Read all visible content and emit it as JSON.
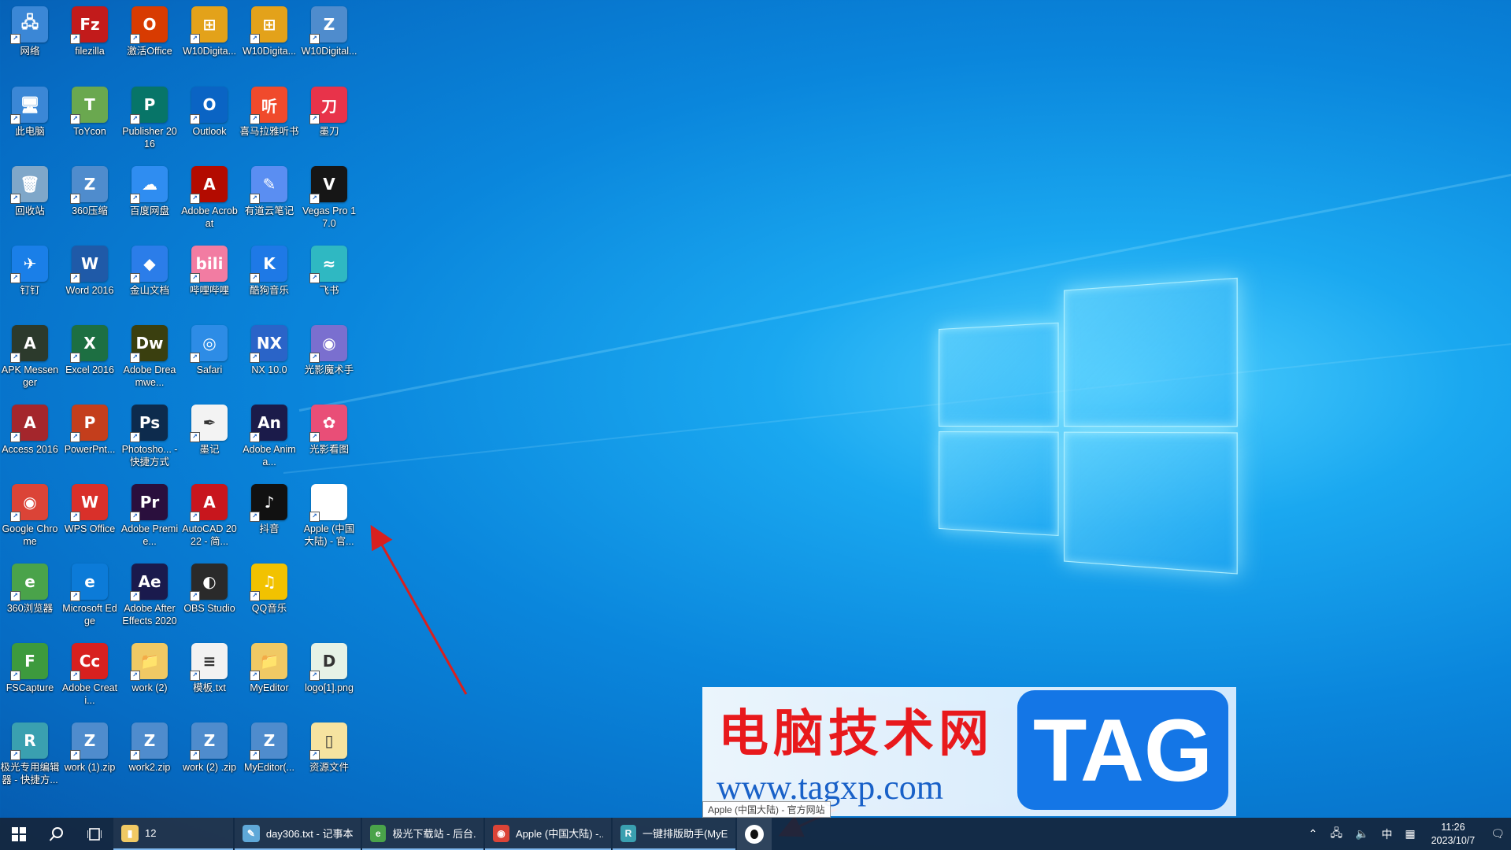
{
  "desktop": {
    "icons": [
      {
        "label": "网络",
        "glyph": "🖧",
        "color": "#3b87d6"
      },
      {
        "label": "filezilla",
        "glyph": "Fz",
        "color": "#c21b1b"
      },
      {
        "label": "激活Office",
        "glyph": "O",
        "color": "#d83b01"
      },
      {
        "label": "W10Digita...",
        "glyph": "⊞",
        "color": "#e3a21a"
      },
      {
        "label": "W10Digita...",
        "glyph": "⊞",
        "color": "#e3a21a"
      },
      {
        "label": "W10Digital...",
        "glyph": "Z",
        "color": "#4f8ccd"
      },
      {
        "label": "此电脑",
        "glyph": "🖥",
        "color": "#3b87d6"
      },
      {
        "label": "ToYcon",
        "glyph": "T",
        "color": "#6aa84f"
      },
      {
        "label": "Publisher 2016",
        "glyph": "P",
        "color": "#077568"
      },
      {
        "label": "Outlook",
        "glyph": "O",
        "color": "#0a64c4"
      },
      {
        "label": "喜马拉雅听书",
        "glyph": "听",
        "color": "#f04a2c"
      },
      {
        "label": "墨刀",
        "glyph": "刀",
        "color": "#e8334a"
      },
      {
        "label": "回收站",
        "glyph": "🗑",
        "color": "#7fa7c9"
      },
      {
        "label": "360压缩",
        "glyph": "Z",
        "color": "#4f8ccd"
      },
      {
        "label": "百度网盘",
        "glyph": "☁",
        "color": "#2f8df1"
      },
      {
        "label": "Adobe Acrobat",
        "glyph": "A",
        "color": "#b30b00"
      },
      {
        "label": "有道云笔记",
        "glyph": "✎",
        "color": "#5a8ef2"
      },
      {
        "label": "Vegas Pro 17.0",
        "glyph": "V",
        "color": "#161616"
      },
      {
        "label": "钉钉",
        "glyph": "✈",
        "color": "#1a7fe8"
      },
      {
        "label": "Word 2016",
        "glyph": "W",
        "color": "#1f5aa8"
      },
      {
        "label": "金山文档",
        "glyph": "◆",
        "color": "#2b7de9"
      },
      {
        "label": "哔哩哔哩",
        "glyph": "bili",
        "color": "#f27ca2"
      },
      {
        "label": "酷狗音乐",
        "glyph": "K",
        "color": "#1e79e6"
      },
      {
        "label": "飞书",
        "glyph": "≈",
        "color": "#2fb8c2"
      },
      {
        "label": "APK Messenger",
        "glyph": "A",
        "color": "#2c3a2c"
      },
      {
        "label": "Excel 2016",
        "glyph": "X",
        "color": "#1d6f42"
      },
      {
        "label": "Adobe Dreamwe...",
        "glyph": "Dw",
        "color": "#3a3f0f"
      },
      {
        "label": "Safari",
        "glyph": "◎",
        "color": "#2d8ce6"
      },
      {
        "label": "NX 10.0",
        "glyph": "NX",
        "color": "#2a64c8"
      },
      {
        "label": "光影魔术手",
        "glyph": "◉",
        "color": "#7a6fcf"
      },
      {
        "label": "Access 2016",
        "glyph": "A",
        "color": "#a4262c"
      },
      {
        "label": "PowerPnt...",
        "glyph": "P",
        "color": "#c43e1c"
      },
      {
        "label": "Photosho... - 快捷方式",
        "glyph": "Ps",
        "color": "#0d2b4d"
      },
      {
        "label": "墨记",
        "glyph": "✒",
        "color": "#f3f3f3"
      },
      {
        "label": "Adobe Anima...",
        "glyph": "An",
        "color": "#1b1b4a"
      },
      {
        "label": "光影看图",
        "glyph": "✿",
        "color": "#e94e77"
      },
      {
        "label": "Google Chrome",
        "glyph": "◉",
        "color": "#db4437"
      },
      {
        "label": "WPS Office",
        "glyph": "W",
        "color": "#d9302a"
      },
      {
        "label": "Adobe Premie...",
        "glyph": "Pr",
        "color": "#2a0f3d"
      },
      {
        "label": "AutoCAD 2022 - 简...",
        "glyph": "A",
        "color": "#c8161d"
      },
      {
        "label": "抖音",
        "glyph": "♪",
        "color": "#111111"
      },
      {
        "label": "Apple (中国大陆) - 官...",
        "glyph": "",
        "color": "#ffffff"
      },
      {
        "label": "360浏览器",
        "glyph": "e",
        "color": "#4aa34a"
      },
      {
        "label": "Microsoft Edge",
        "glyph": "e",
        "color": "#0c7bd8"
      },
      {
        "label": "Adobe After Effects 2020",
        "glyph": "Ae",
        "color": "#1a1a4d"
      },
      {
        "label": "OBS Studio",
        "glyph": "◐",
        "color": "#2a2a2a"
      },
      {
        "label": "QQ音乐",
        "glyph": "♫",
        "color": "#f2c200"
      },
      {
        "label": "FSCapture",
        "glyph": "F",
        "color": "#3d9a3d"
      },
      {
        "label": "Adobe Creati...",
        "glyph": "Cc",
        "color": "#d8201f"
      },
      {
        "label": "work (2)",
        "glyph": "📁",
        "color": "#f0c964"
      },
      {
        "label": "模板.txt",
        "glyph": "≡",
        "color": "#f2f2f2"
      },
      {
        "label": "MyEditor",
        "glyph": "📁",
        "color": "#f0c964"
      },
      {
        "label": "logo[1].png",
        "glyph": "D",
        "color": "#e6f2e6"
      },
      {
        "label": "极光专用编辑器 - 快捷方...",
        "glyph": "R",
        "color": "#3aa0b0"
      },
      {
        "label": "work (1).zip",
        "glyph": "Z",
        "color": "#4f8ccd"
      },
      {
        "label": "work2.zip",
        "glyph": "Z",
        "color": "#4f8ccd"
      },
      {
        "label": "work (2) .zip",
        "glyph": "Z",
        "color": "#4f8ccd"
      },
      {
        "label": "MyEditor(...",
        "glyph": "Z",
        "color": "#4f8ccd"
      },
      {
        "label": "资源文件",
        "glyph": "▯",
        "color": "#f6e3a0"
      }
    ]
  },
  "watermark": {
    "title": "电脑技术网",
    "url": "www.tagxp.com",
    "tag": "TAG",
    "tooltip": "Apple (中国大陆) - 官方网站"
  },
  "taskbar": {
    "start_icon": "windows-icon",
    "search_icon": "search-icon",
    "taskview_icon": "task-view-icon",
    "tasks": [
      {
        "label": "12",
        "icon": "folder-icon",
        "color": "#f0c964",
        "glyph": "▮"
      },
      {
        "label": "day306.txt - 记事本",
        "icon": "notepad-icon",
        "color": "#5fa8d8",
        "glyph": "✎"
      },
      {
        "label": "极光下载站 - 后台...",
        "icon": "browser-icon",
        "color": "#4aa34a",
        "glyph": "e"
      },
      {
        "label": "Apple (中国大陆) -...",
        "icon": "chrome-icon",
        "color": "#db4437",
        "glyph": "◉"
      },
      {
        "label": "一键排版助手(MyE...",
        "icon": "editor-icon",
        "color": "#3aa0b0",
        "glyph": "R"
      }
    ],
    "pinned_apple_icon": "apple-icon",
    "tray": {
      "ime": "中",
      "time": "11:26",
      "date": "2023/10/7"
    }
  },
  "colors": {
    "desktop_bg": "#0a86dc",
    "taskbar_bg": "#14263c",
    "arrow": "#d8201f"
  }
}
